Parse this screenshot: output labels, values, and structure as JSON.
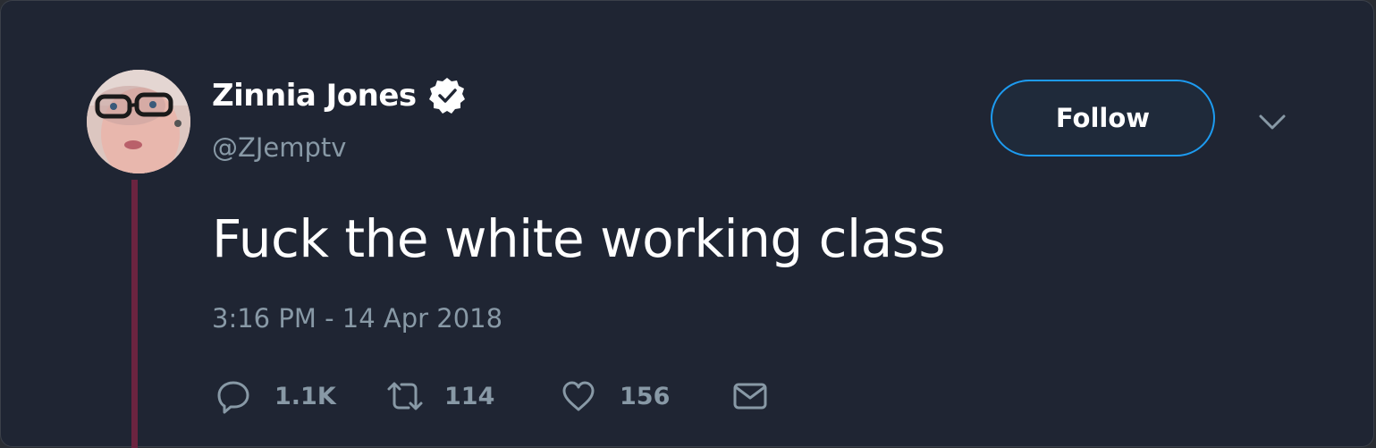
{
  "user": {
    "display_name": "Zinnia Jones",
    "handle": "@ZJemptv",
    "verified": true
  },
  "header": {
    "follow_label": "Follow"
  },
  "tweet": {
    "text": "Fuck the white working class",
    "timestamp": "3:16 PM - 14 Apr 2018"
  },
  "actions": {
    "replies": "1.1K",
    "retweets": "114",
    "likes": "156"
  },
  "icons": {
    "verified": "verified-badge-icon",
    "caret": "chevron-down-icon",
    "reply": "reply-icon",
    "retweet": "retweet-icon",
    "like": "heart-icon",
    "dm": "envelope-icon"
  },
  "colors": {
    "background": "#1f2533",
    "accent": "#1d9bf0",
    "muted": "#8899a6",
    "thread": "#6b2440"
  }
}
